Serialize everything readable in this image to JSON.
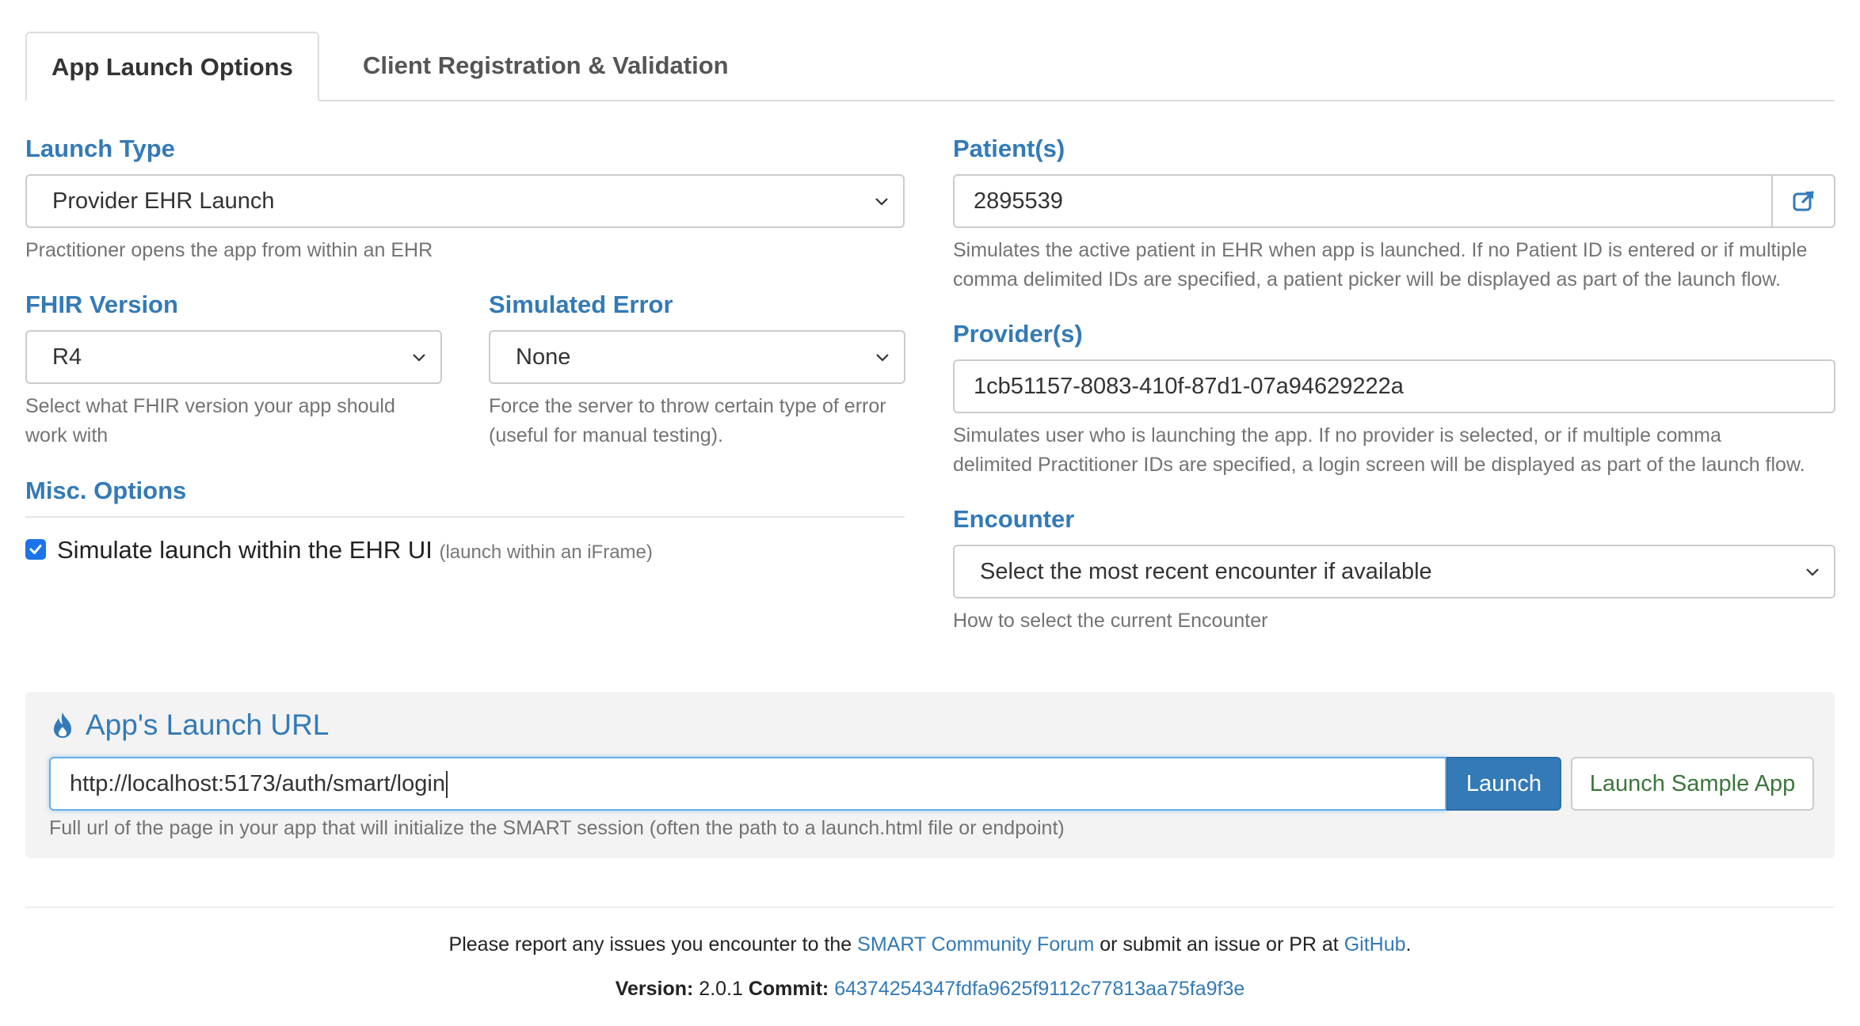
{
  "tabs": {
    "active": "App Launch Options",
    "inactive": "Client Registration & Validation"
  },
  "launch_type": {
    "label": "Launch Type",
    "value": "Provider EHR Launch",
    "help": "Practitioner opens the app from within an EHR"
  },
  "fhir_version": {
    "label": "FHIR Version",
    "value": "R4",
    "help_line1": "Select what FHIR version your app should",
    "help_line2": "work with"
  },
  "simulated_error": {
    "label": "Simulated Error",
    "value": "None",
    "help_line1": "Force the server to throw certain type of error",
    "help_line2": "(useful for manual testing)."
  },
  "misc": {
    "label": "Misc. Options",
    "checkbox_checked": true,
    "checkbox_label": "Simulate launch within the EHR UI",
    "checkbox_note": "(launch within an iFrame)"
  },
  "patients": {
    "label": "Patient(s)",
    "value": "2895539",
    "help_line1": "Simulates the active patient in EHR when app is launched. If no Patient ID is entered or if multiple",
    "help_line2": "comma delimited IDs are specified, a patient picker will be displayed as part of the launch flow."
  },
  "providers": {
    "label": "Provider(s)",
    "value": "1cb51157-8083-410f-87d1-07a94629222a",
    "help_line1": "Simulates user who is launching the app. If no provider is selected, or if multiple comma",
    "help_line2": "delimited Practitioner IDs are specified, a login screen will be displayed as part of the launch flow."
  },
  "encounter": {
    "label": "Encounter",
    "value": "Select the most recent encounter if available",
    "help": "How to select the current Encounter"
  },
  "launch_url": {
    "title": "App's Launch URL",
    "value": "http://localhost:5173/auth/smart/login",
    "launch_button": "Launch",
    "sample_button": "Launch Sample App",
    "help": "Full url of the page in your app that will initialize the SMART session (often the path to a launch.html file or endpoint)"
  },
  "footer": {
    "prefix": "Please report any issues you encounter to the ",
    "forum_link": "SMART Community Forum",
    "middle": " or submit an issue or PR at ",
    "github_link": "GitHub",
    "suffix": ".",
    "version_label": "Version:",
    "version_value": "2.0.1",
    "commit_label": "Commit:",
    "commit_value": "64374254347fdfa9625f9112c77813aa75fa9f3e"
  },
  "colors": {
    "accent": "#337ab7",
    "checkbox": "#1a73e8",
    "sample_button_text": "#3c763d"
  },
  "icons": {
    "select_chevron": "chevron-down-icon",
    "patient_picker": "external-link-icon",
    "panel_title": "fire-icon",
    "checkbox": "checkmark-icon"
  }
}
